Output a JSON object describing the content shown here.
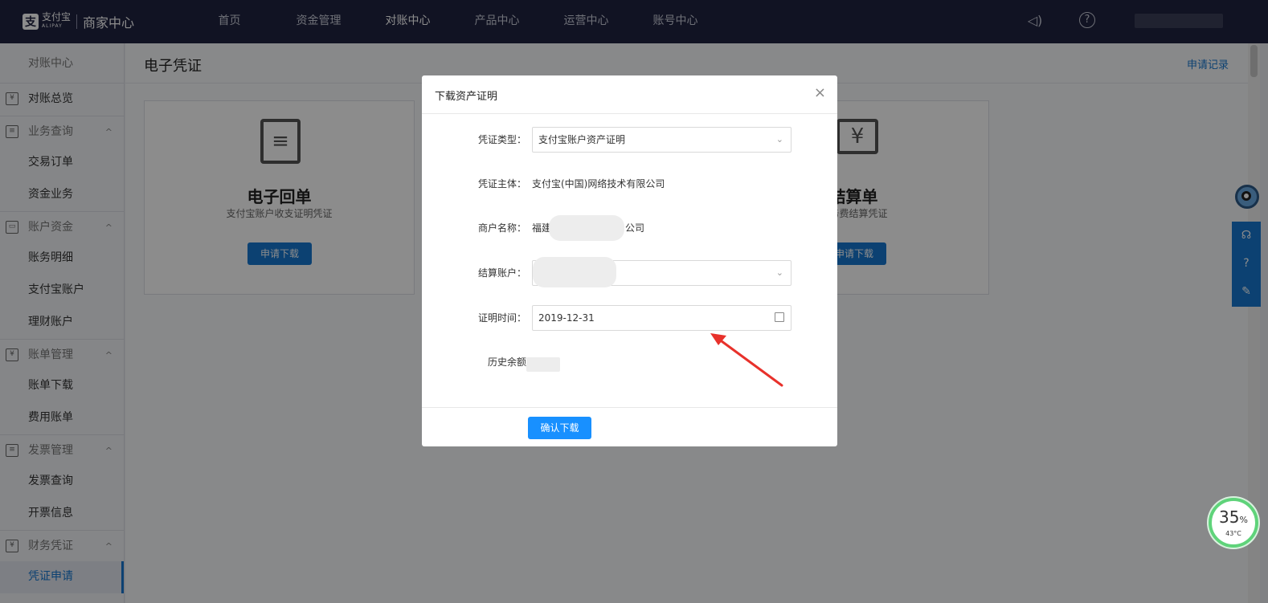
{
  "topbar": {
    "logo_mark": "支",
    "logo_text": "支付宝",
    "logo_sub": "ALIPAY",
    "center_title": "商家中心",
    "nav": [
      "首页",
      "资金管理",
      "对账中心",
      "产品中心",
      "运营中心",
      "账号中心"
    ],
    "active_nav": "对账中心",
    "speaker_icon": "◁)",
    "help_icon": "?"
  },
  "sidebar": {
    "title": "对账中心",
    "rows": [
      {
        "label": "对账总览",
        "icon": "¥",
        "type": "item-icon"
      },
      {
        "label": "业务查询",
        "icon": "≡",
        "type": "group"
      },
      {
        "label": "交易订单",
        "type": "item"
      },
      {
        "label": "资金业务",
        "type": "item"
      },
      {
        "label": "账户资金",
        "icon": "▭",
        "type": "group"
      },
      {
        "label": "账务明细",
        "type": "item"
      },
      {
        "label": "支付宝账户",
        "type": "item"
      },
      {
        "label": "理财账户",
        "type": "item"
      },
      {
        "label": "账单管理",
        "icon": "¥",
        "type": "group"
      },
      {
        "label": "账单下载",
        "type": "item"
      },
      {
        "label": "费用账单",
        "type": "item"
      },
      {
        "label": "发票管理",
        "icon": "≡",
        "type": "group"
      },
      {
        "label": "发票查询",
        "type": "item"
      },
      {
        "label": "开票信息",
        "type": "item"
      },
      {
        "label": "财务凭证",
        "icon": "¥",
        "type": "group"
      },
      {
        "label": "凭证申请",
        "type": "active"
      }
    ],
    "chevron": "^"
  },
  "main": {
    "title": "电子凭证",
    "apply_record": "申请记录",
    "cards": [
      {
        "title": "电子回单",
        "subtitle": "支付宝账户收支证明凭证",
        "button": "申请下载",
        "icon": "≡"
      },
      {
        "title": "结算单",
        "subtitle": "服务费结算凭证",
        "button": "申请下载",
        "icon": "¥"
      }
    ]
  },
  "float": {
    "buttons": [
      "☊",
      "?",
      "✎"
    ]
  },
  "gauge": {
    "value": "35",
    "unit": "%",
    "temp": "43°C"
  },
  "modal": {
    "title": "下载资产证明",
    "close": "×",
    "voucher_type_label": "凭证类型：",
    "voucher_type_value": "支付宝账户资产证明",
    "subject_label": "凭证主体：",
    "subject_value": "支付宝(中国)网络技术有限公司",
    "merchant_label": "商户名称：",
    "merchant_value_prefix": "福建",
    "merchant_value_suffix": "公司",
    "settle_label": "结算账户：",
    "date_label": "证明时间：",
    "date_value": "2019-12-31",
    "balance_label": "历史余额",
    "confirm": "确认下载",
    "dropdown_chevron": "⌄"
  },
  "colors": {
    "topbar": "#202340",
    "accent": "#1677cf",
    "button": "#1890ff",
    "arrow": "#e8312b",
    "gauge": "#5fd37a"
  }
}
